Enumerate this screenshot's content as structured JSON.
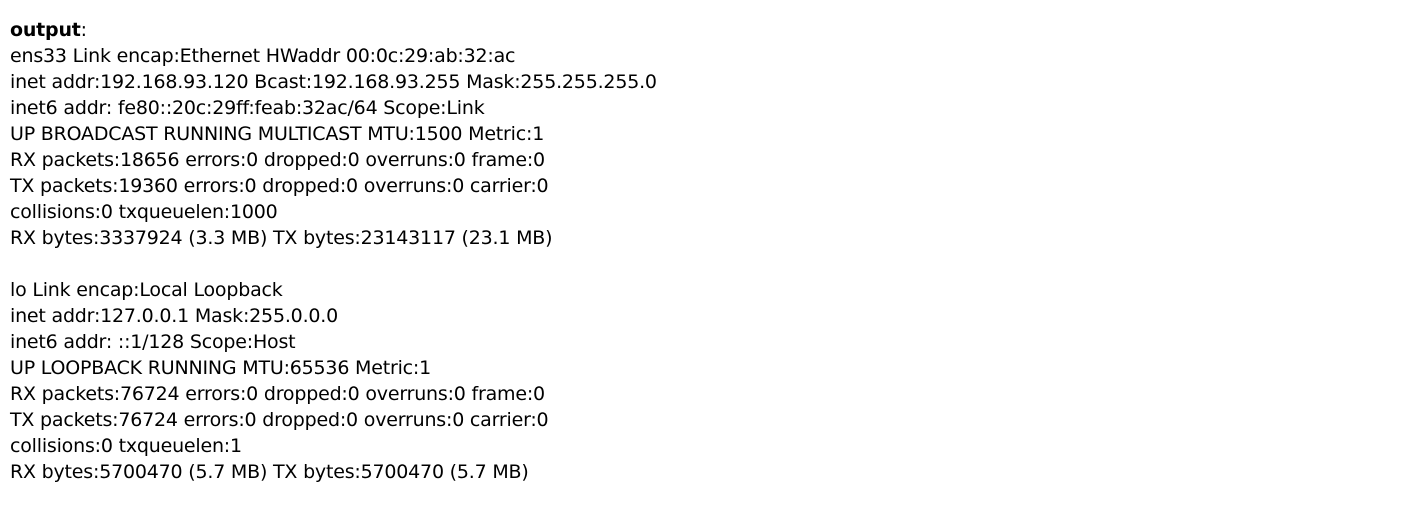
{
  "heading": {
    "label": "output",
    "suffix": ":"
  },
  "interfaces": [
    {
      "lines": [
        "ens33 Link encap:Ethernet HWaddr 00:0c:29:ab:32:ac",
        "inet addr:192.168.93.120 Bcast:192.168.93.255 Mask:255.255.255.0",
        "inet6 addr: fe80::20c:29ff:feab:32ac/64 Scope:Link",
        "UP BROADCAST RUNNING MULTICAST MTU:1500 Metric:1",
        "RX packets:18656 errors:0 dropped:0 overruns:0 frame:0",
        "TX packets:19360 errors:0 dropped:0 overruns:0 carrier:0",
        "collisions:0 txqueuelen:1000",
        "RX bytes:3337924 (3.3 MB) TX bytes:23143117 (23.1 MB)"
      ]
    },
    {
      "lines": [
        "lo Link encap:Local Loopback",
        "inet addr:127.0.0.1 Mask:255.0.0.0",
        "inet6 addr: ::1/128 Scope:Host",
        "UP LOOPBACK RUNNING MTU:65536 Metric:1",
        "RX packets:76724 errors:0 dropped:0 overruns:0 frame:0",
        "TX packets:76724 errors:0 dropped:0 overruns:0 carrier:0",
        "collisions:0 txqueuelen:1",
        "RX bytes:5700470 (5.7 MB) TX bytes:5700470 (5.7 MB)"
      ]
    }
  ]
}
